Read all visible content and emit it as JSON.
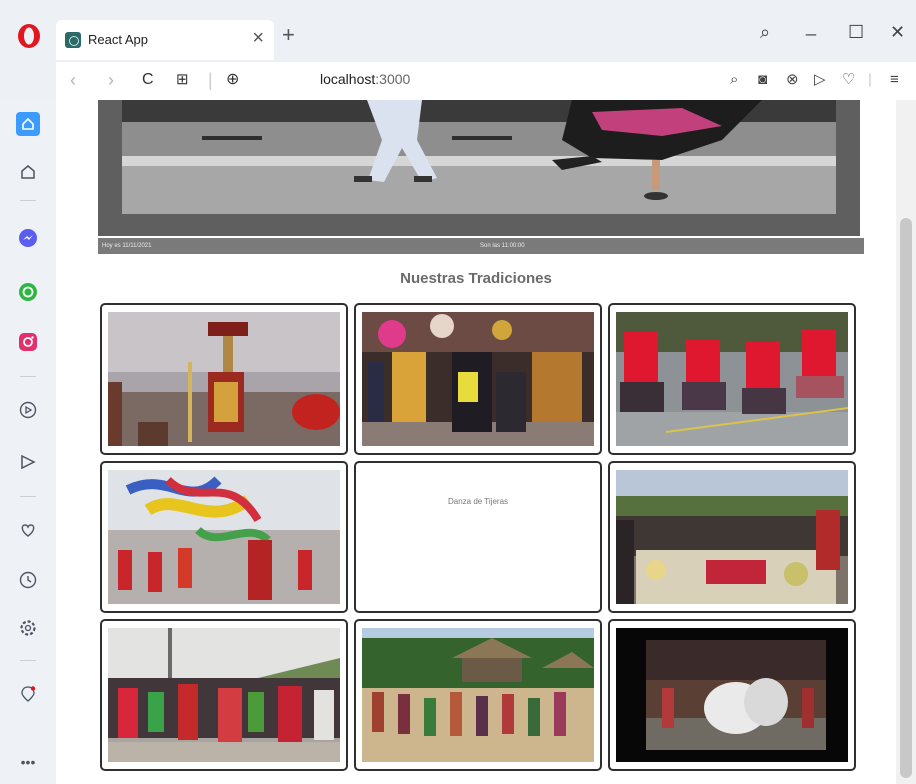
{
  "browser": {
    "tab_title": "React App",
    "tab_close": "×",
    "new_tab": "+",
    "address_host": "localhost",
    "address_port": ":3000",
    "nav": {
      "back": "‹",
      "forward": "›",
      "reload": "C",
      "speed_dial": "⊞",
      "site_info": "⊕"
    },
    "window_controls": {
      "search": "⌕",
      "minimize": "_",
      "maximize": "☐",
      "close": "✕"
    },
    "toolbar_icons": {
      "snap": "⌕",
      "camera": "◙",
      "block": "⊗",
      "send": "▷",
      "heart": "♡",
      "menu": "≡"
    }
  },
  "sidebar": {
    "icons": [
      "home-icon",
      "bookmark-icon",
      "messenger-icon",
      "whatsapp-icon",
      "instagram-icon",
      "player-icon",
      "send-icon",
      "heart-icon",
      "history-icon",
      "settings-icon",
      "tips-icon",
      "more-icon"
    ]
  },
  "page": {
    "hero_caption_left": "Hoy es 11/11/2021",
    "hero_caption_right": "Son las 11:00:00",
    "section_title": "Nuestras Tradiciones",
    "gallery": [
      {
        "label": "",
        "theme": "inti"
      },
      {
        "label": "",
        "theme": "festival"
      },
      {
        "label": "",
        "theme": "red-dancers"
      },
      {
        "label": "",
        "theme": "ribbons"
      },
      {
        "label": "Danza de Tijeras",
        "theme": "missing"
      },
      {
        "label": "",
        "theme": "market"
      },
      {
        "label": "",
        "theme": "crowd"
      },
      {
        "label": "",
        "theme": "jungle"
      },
      {
        "label": "",
        "theme": "stage"
      }
    ]
  },
  "colors": {
    "opera_red": "#e0171f",
    "frame": "#eef2f7",
    "card_border": "#2f2f2f"
  }
}
